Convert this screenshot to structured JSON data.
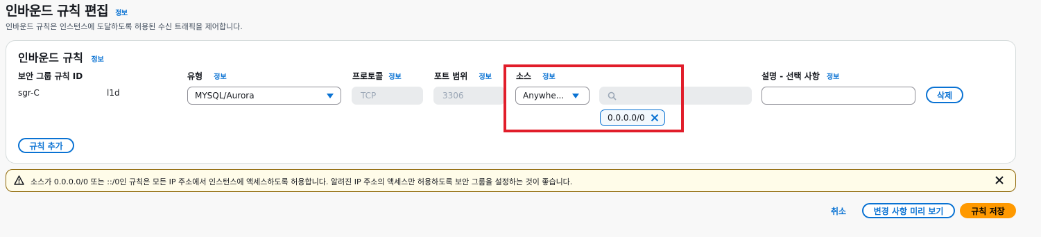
{
  "header": {
    "title": "인바운드 규칙 편집",
    "info_label": "정보",
    "description": "인바운드 규칙은 인스턴스에 도달하도록 허용된 수신 트래픽을 제어합니다."
  },
  "rules_panel": {
    "title": "인바운드 규칙",
    "info_label": "정보",
    "columns": {
      "rule_id": "보안 그룹 규칙 ID",
      "type": "유형",
      "protocol": "프로토콜",
      "port_range": "포트 범위",
      "source": "소스",
      "description": "설명 - 선택 사항"
    },
    "row": {
      "rule_id_prefix": "sgr-C",
      "rule_id_suffix": "l1d",
      "type_value": "MYSQL/Aurora",
      "protocol_value": "TCP",
      "port_value": "3306",
      "source_value": "Anywhe...",
      "source_search_value": "",
      "source_token": "0.0.0.0/0",
      "description_value": "",
      "delete_label": "삭제"
    },
    "add_rule_label": "규칙 추가"
  },
  "alert": {
    "text": "소스가 0.0.0.0/0 또는 ::/0인 규칙은 모든 IP 주소에서 인스턴스에 액세스하도록 허용합니다. 알려진 IP 주소의 액세스만 허용하도록 보안 그룹을 설정하는 것이 좋습니다."
  },
  "footer": {
    "cancel_label": "취소",
    "preview_label": "변경 사항 미리 보기",
    "save_label": "규칙 저장"
  },
  "colors": {
    "accent": "#0972d3",
    "primary_button": "#ff9900",
    "highlight": "#e11d2a",
    "warning_bg": "#fffce9"
  },
  "icons": [
    "warning-icon",
    "close-icon",
    "search-icon",
    "chevron-down-icon",
    "token-remove-icon"
  ]
}
